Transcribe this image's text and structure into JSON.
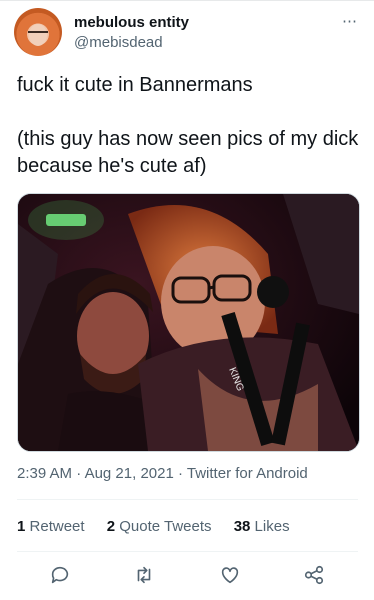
{
  "author": {
    "display_name": "mebulous entity",
    "handle": "@mebisdead",
    "more_icon": "⋯"
  },
  "tweet": {
    "text": "fuck it cute in Bannermans\n\n(this guy has now seen pics of my dick because he's cute af)",
    "time": "2:39 AM",
    "date": "Aug 21, 2021",
    "source": "Twitter for Android",
    "separator": "·"
  },
  "media": {
    "tag_text": "KING"
  },
  "stats": {
    "retweets_count": "1",
    "retweets_label": "Retweet",
    "quotes_count": "2",
    "quotes_label": "Quote Tweets",
    "likes_count": "38",
    "likes_label": "Likes"
  },
  "actions": [
    "reply-icon",
    "retweet-icon",
    "like-icon",
    "share-icon"
  ],
  "colors": {
    "text": "#0f1419",
    "secondary": "#536471",
    "divider": "#eff3f4"
  }
}
